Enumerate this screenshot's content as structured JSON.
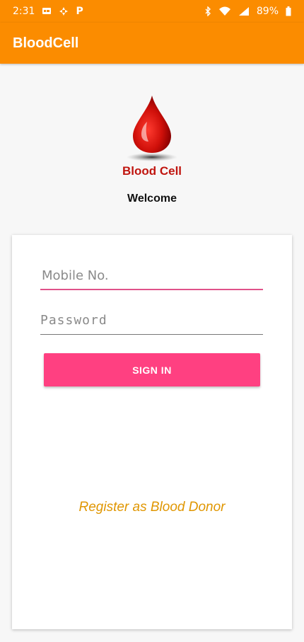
{
  "status_bar": {
    "time": "2:31",
    "battery": "89%",
    "icons": [
      "messaging-icon",
      "pinwheel-icon",
      "parking-icon",
      "bluetooth-icon",
      "wifi-icon",
      "signal-icon",
      "battery-icon"
    ]
  },
  "app_bar": {
    "title": "BloodCell"
  },
  "logo": {
    "text": "Blood Cell",
    "color": "#c0150f"
  },
  "welcome": "Welcome",
  "form": {
    "mobile_placeholder": "Mobile No.",
    "password_placeholder": "Password",
    "signin_label": "SIGN IN",
    "register_link": "Register as Blood Donor"
  },
  "colors": {
    "primary": "#fb8c00",
    "accent": "#ff4081",
    "link": "#e09600"
  }
}
